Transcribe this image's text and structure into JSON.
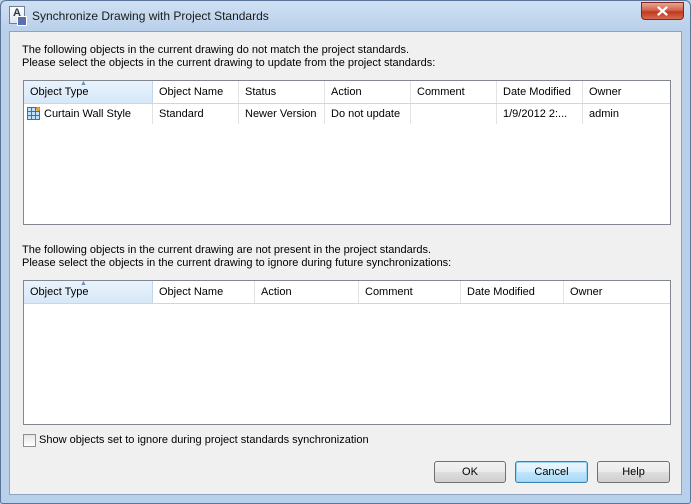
{
  "window": {
    "title": "Synchronize Drawing with Project Standards",
    "app_icon": "autocad-architecture-icon",
    "close_icon": "close-icon"
  },
  "section1": {
    "line1": "The following objects in the current drawing do not match the project standards.",
    "line2": "Please select the objects in the current drawing to update from the project standards:",
    "columns": [
      "Object Type",
      "Object Name",
      "Status",
      "Action",
      "Comment",
      "Date Modified",
      "Owner"
    ],
    "rows": [
      {
        "icon": "curtain-wall-style-icon",
        "object_type": "Curtain Wall Style",
        "object_name": "Standard",
        "status": "Newer Version",
        "action": "Do not update",
        "comment": "",
        "date_modified": "1/9/2012 2:...",
        "owner": "admin"
      }
    ]
  },
  "section2": {
    "line1": "The following objects in the current drawing are not present in the project standards.",
    "line2": "Please select the objects in the current drawing to ignore during future synchronizations:",
    "columns": [
      "Object Type",
      "Object Name",
      "Action",
      "Comment",
      "Date Modified",
      "Owner"
    ],
    "rows": []
  },
  "checkbox": {
    "label": "Show objects set to ignore during project standards synchronization",
    "checked": false
  },
  "buttons": {
    "ok": "OK",
    "cancel": "Cancel",
    "help": "Help"
  },
  "colors": {
    "title_bar": "#cfe0f3",
    "close_button": "#c9452a",
    "sorted_header": "#dcebf9",
    "default_button_border": "#3c7fb1"
  }
}
